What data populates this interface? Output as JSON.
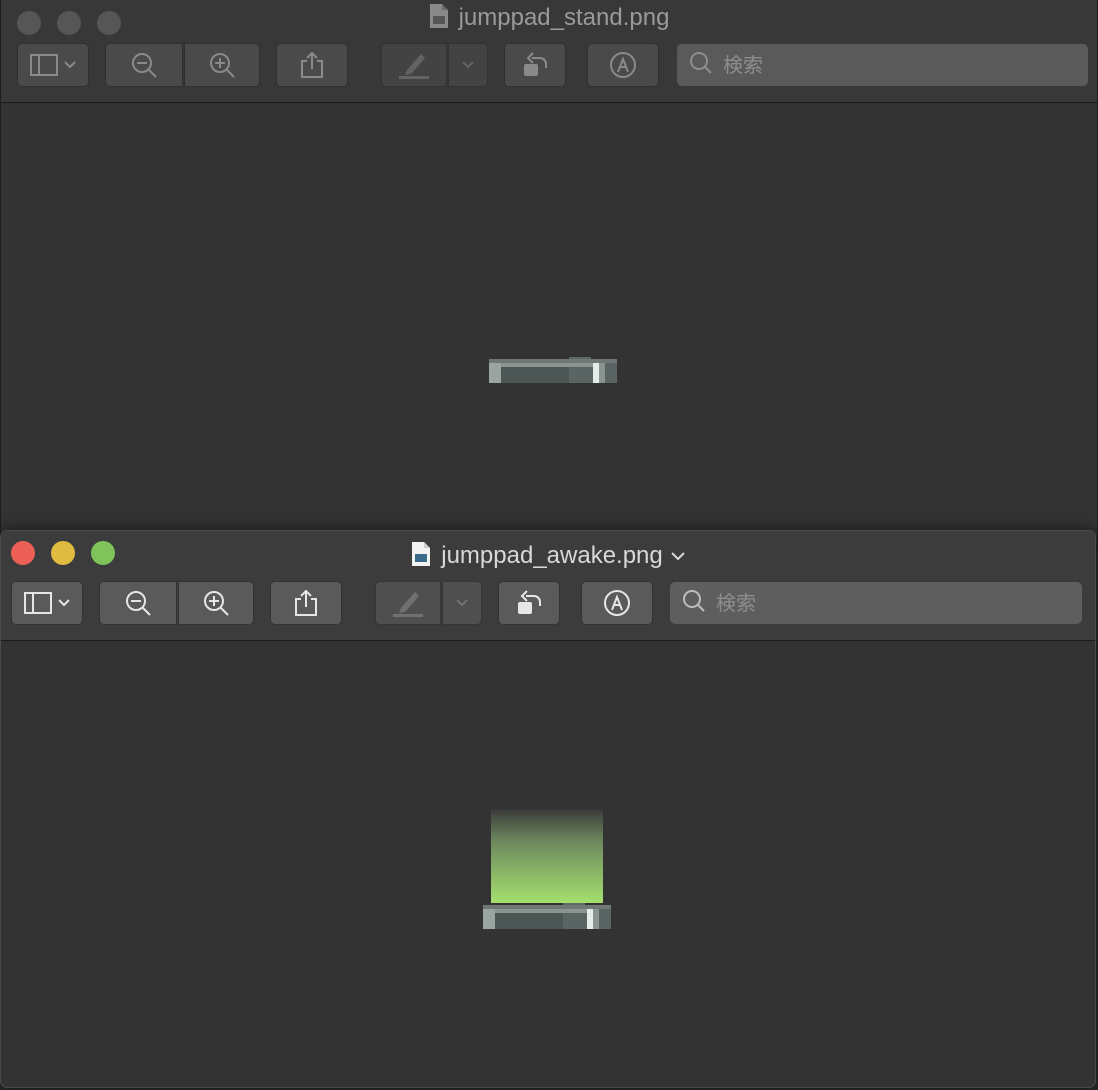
{
  "windows": {
    "back": {
      "title": "jumppad_stand.png",
      "search_placeholder": "検索",
      "active": false
    },
    "front": {
      "title": "jumppad_awake.png",
      "search_placeholder": "検索",
      "active": true
    }
  },
  "toolbar_icons": [
    "sidebar-icon",
    "chevron-down-icon",
    "zoom-out-icon",
    "zoom-in-icon",
    "share-icon",
    "highlighter-icon",
    "rotate-icon",
    "markup-icon",
    "search-icon"
  ],
  "colors": {
    "close": "#ec5f57",
    "minimize": "#e0bb41",
    "zoom": "#7fc35a",
    "glow": "#a4e06e",
    "pad_dark": "#4c5654",
    "pad_light": "#8a9592",
    "pad_highlight": "#e4ecea"
  }
}
